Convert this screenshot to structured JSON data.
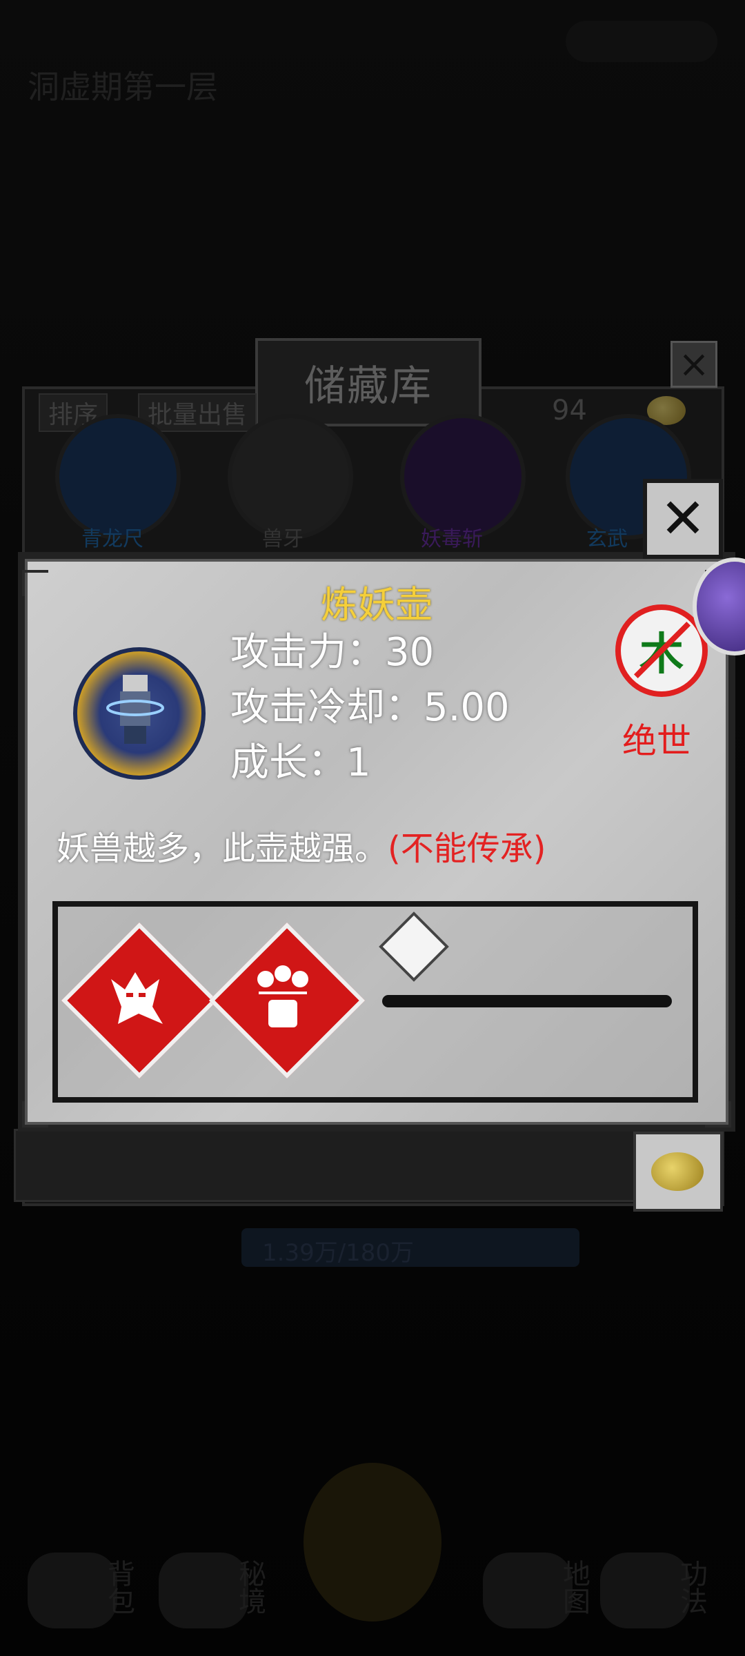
{
  "background": {
    "location": "洞虚期第一层",
    "cultivation_progress": "1.39万/180万",
    "bottom_nav": [
      "背包",
      "秘境",
      "地图",
      "功法"
    ]
  },
  "storage": {
    "title": "储藏库",
    "sort_label": "排序",
    "batch_sell_label": "批量出售",
    "coin_count": "94",
    "slots": [
      {
        "label": "青龙尺",
        "color": "#3a8fd6"
      },
      {
        "label": "兽牙",
        "color": "#9a9a9a"
      },
      {
        "label": "妖毒斩",
        "color": "#9a3ad6"
      },
      {
        "label": "玄武",
        "color": "#3a8fd6"
      }
    ]
  },
  "item": {
    "name": "炼妖壶",
    "attack_label": "攻击力：",
    "attack_value": "30",
    "cooldown_label": "攻击冷却：",
    "cooldown_value": "5.00",
    "growth_label": "成长：",
    "growth_value": "1",
    "description": "妖兽越多，此壶越强。",
    "note": "(不能传承)",
    "element": "木",
    "rarity": "绝世",
    "skills": [
      "ghost-beast",
      "three-heads-pot"
    ]
  },
  "colors": {
    "title_gold": "#f5cf3a",
    "rarity_red": "#e31d1d",
    "element_green": "#0f7a1a",
    "skill_red": "#d01616"
  }
}
